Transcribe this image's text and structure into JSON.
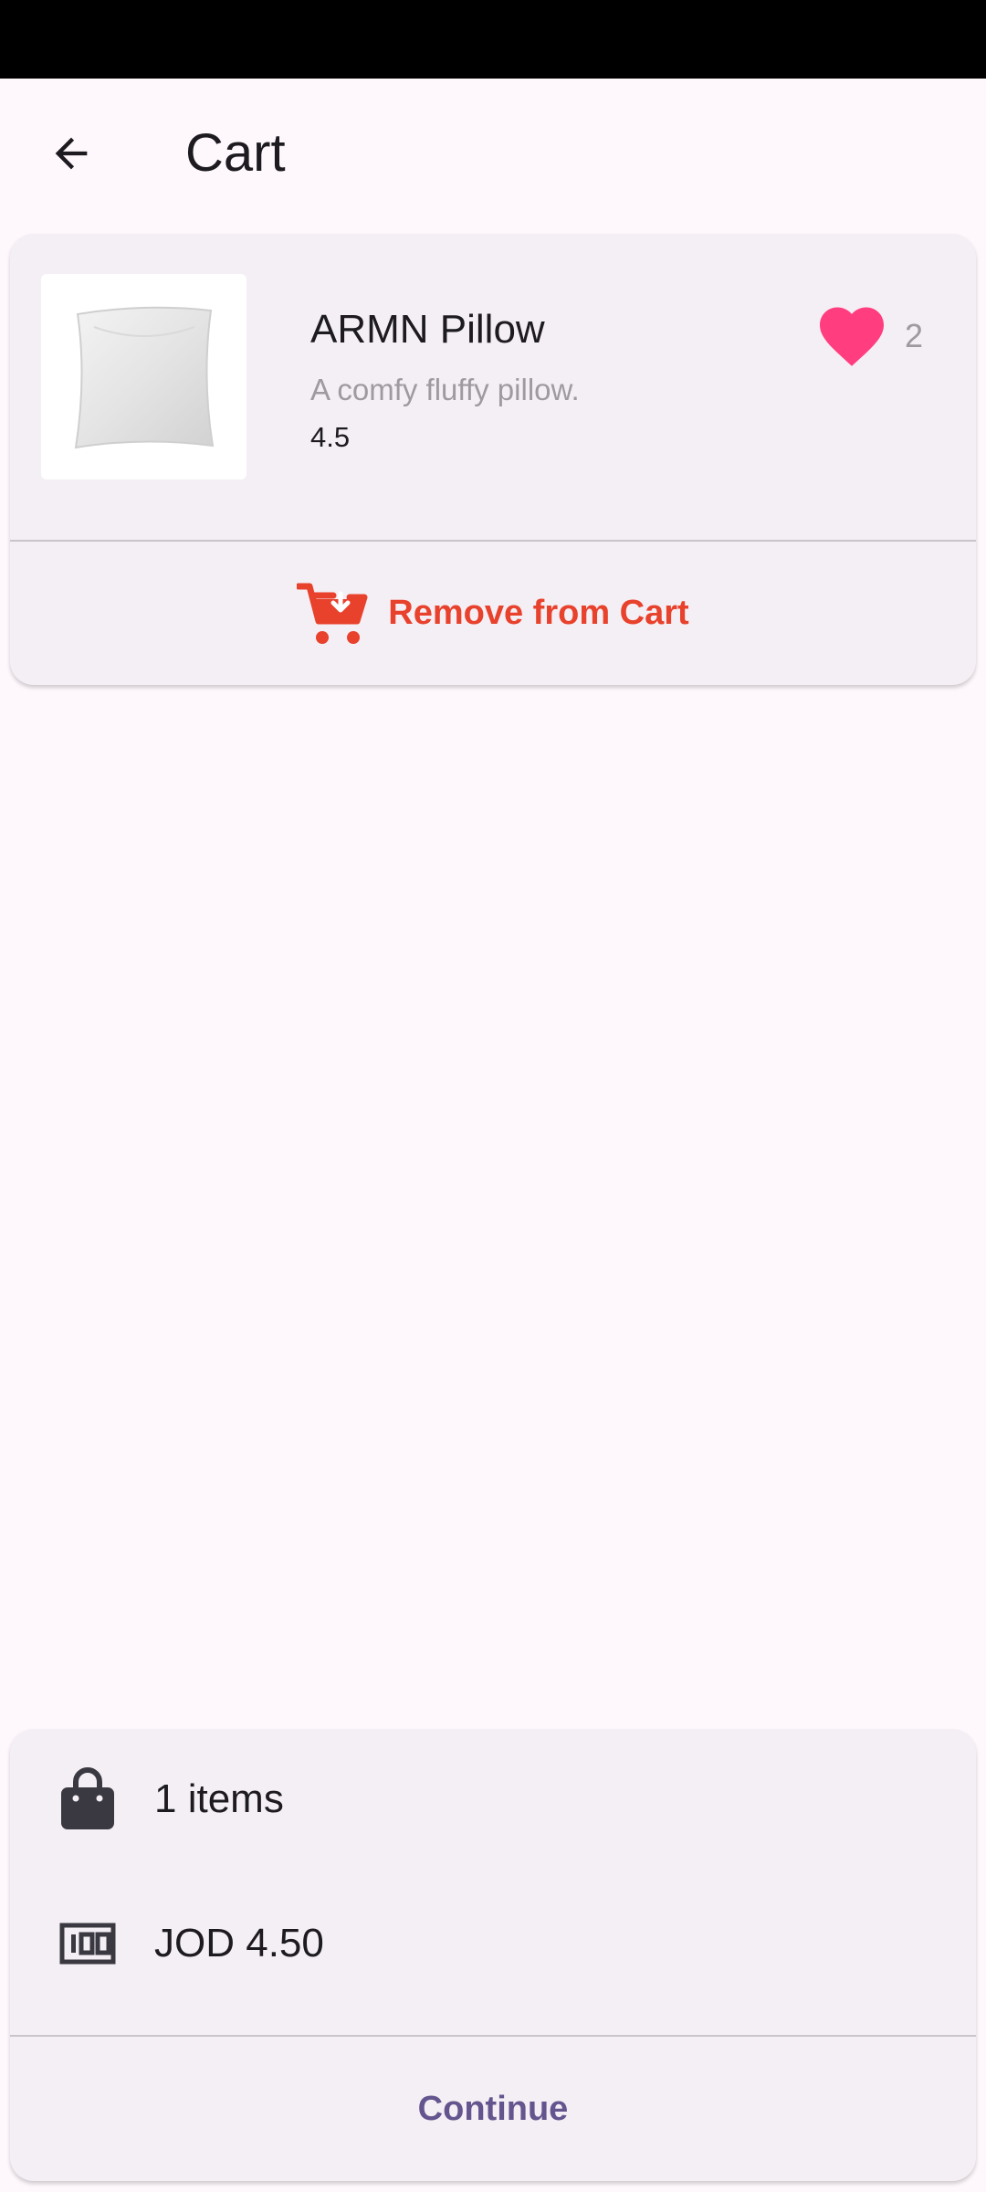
{
  "app_bar": {
    "title": "Cart"
  },
  "cart_items": [
    {
      "name": "ARMN Pillow",
      "description": "A comfy fluffy pillow.",
      "rating": "4.5",
      "favorite_count": "2",
      "image": "pillow-image",
      "remove_label": "Remove from Cart"
    }
  ],
  "summary": {
    "items_text": "1 items",
    "total_text": "JOD 4.50",
    "continue_label": "Continue"
  },
  "colors": {
    "background": "#FEF7FC",
    "card": "#F4EFF4",
    "remove": "#E8412C",
    "heart": "#FF3D7F",
    "accent": "#65558F"
  }
}
